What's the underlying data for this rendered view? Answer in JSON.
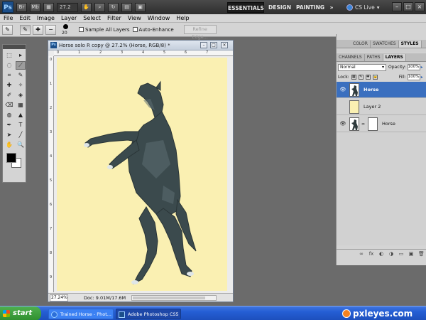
{
  "titlebar": {
    "logo": "Ps",
    "zoom_value": "27.2",
    "workspaces": [
      "ESSENTIALS",
      "DESIGN",
      "PAINTING"
    ],
    "more": "»",
    "cs_live": "CS Live",
    "controls": [
      "–",
      "□",
      "×"
    ]
  },
  "menu": [
    "File",
    "Edit",
    "Image",
    "Layer",
    "Select",
    "Filter",
    "View",
    "Window",
    "Help"
  ],
  "options": {
    "brush_size": "20",
    "sample_all_layers": "Sample All Layers",
    "auto_enhance": "Auto-Enhance",
    "refine_edge": "Refine Edge..."
  },
  "tools": [
    "⬚",
    "▸",
    "◌",
    "⟋",
    "⌗",
    "✎",
    "✚",
    "✧",
    "✐",
    "◈",
    "⌫",
    "▦",
    "◍",
    "▲",
    "✒",
    "T",
    "➤",
    "╱",
    "✋",
    "🔍"
  ],
  "colors": {
    "foreground": "#000000",
    "background": "#ffffff",
    "canvas": "#faf0b2",
    "selection": "#3a6fbf"
  },
  "document": {
    "title": "Horse solo R copy @ 27.2% (Horse, RGB/8) *",
    "zoom": "27.24%",
    "doc_info": "Doc: 9.01M/17.6M",
    "ruler_top": [
      "0",
      "1",
      "2",
      "3",
      "4",
      "5",
      "6",
      "7"
    ],
    "ruler_left": [
      "0",
      "1",
      "2",
      "3",
      "4",
      "5",
      "6",
      "7",
      "8",
      "9"
    ]
  },
  "panels": {
    "top_tabs": [
      "COLOR",
      "SWATCHES",
      "STYLES"
    ],
    "layer_tabs": [
      "CHANNELS",
      "PATHS",
      "LAYERS"
    ],
    "blend_mode": "Normal",
    "opacity_label": "Opacity:",
    "opacity_value": "100%",
    "lock_label": "Lock:",
    "fill_label": "Fill:",
    "fill_value": "100%",
    "layers": [
      {
        "name": "Horse",
        "selected": true
      },
      {
        "name": "Layer 2",
        "selected": false
      },
      {
        "name": "Horse",
        "selected": false
      }
    ],
    "footer_icons": [
      "∞",
      "fx",
      "◐",
      "◑",
      "▭",
      "▣",
      "🗑"
    ]
  },
  "taskbar": {
    "start": "start",
    "tasks": [
      "Trained Horse - Phot...",
      "Adobe Photoshop CS5"
    ],
    "watermark": "pxleyes.com"
  }
}
